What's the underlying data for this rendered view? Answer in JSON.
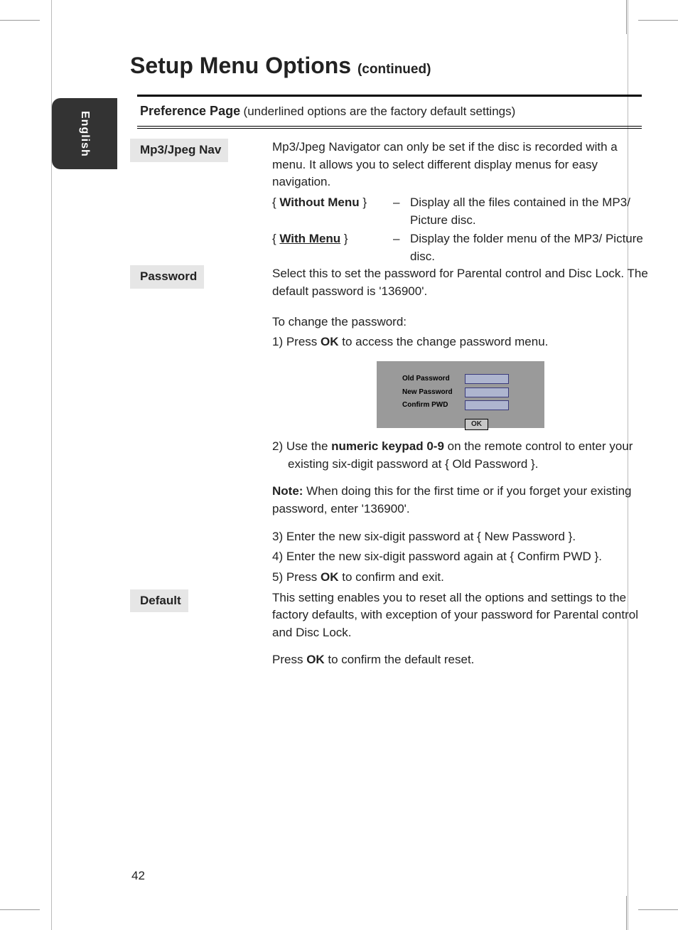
{
  "lang_tab": "English",
  "title_main": "Setup Menu Options",
  "title_cont": "(continued)",
  "section_title": "Preference Page",
  "section_sub": "(underlined options are the factory default settings)",
  "page_number": "42",
  "mp3": {
    "label": "Mp3/Jpeg Nav",
    "intro": "Mp3/Jpeg Navigator can only be set if the disc is recorded with a menu. It allows you to select different display menus for easy navigation.",
    "opt1_name": "Without Menu",
    "opt1_desc": "Display all the files contained in the MP3/ Picture disc.",
    "opt2_name": "With Menu",
    "opt2_desc": "Display the folder menu of the MP3/ Picture disc."
  },
  "pwd": {
    "label": "Password",
    "intro": "Select this to set the password for Parental control and Disc Lock. The default password is '136900'.",
    "change_head": "To change the password:",
    "step1_a": "1)  Press ",
    "step1_ok": "OK",
    "step1_b": " to access the change password menu.",
    "dlg_old": "Old  Password",
    "dlg_new": "New Password",
    "dlg_conf": "Confirm PWD",
    "dlg_ok": "OK",
    "step2_a": "2)  Use the ",
    "step2_bold": "numeric keypad 0-9",
    "step2_b": " on the remote control to enter your existing six-digit password at { Old Password }.",
    "note_head": "Note:",
    "note_body": "  When doing this for the first time or if you forget your existing password, enter '136900'.",
    "step3": "3)  Enter the new six-digit password at { New Password }.",
    "step4": "4)  Enter the new six-digit password again at { Confirm PWD }.",
    "step5_a": "5)  Press ",
    "step5_ok": "OK",
    "step5_b": " to confirm and exit."
  },
  "def": {
    "label": "Default",
    "intro": "This setting enables you to reset all the options and settings to the factory defaults, with exception of your password for Parental control and Disc Lock.",
    "press_a": "Press ",
    "press_ok": "OK",
    "press_b": " to confirm the default reset."
  }
}
